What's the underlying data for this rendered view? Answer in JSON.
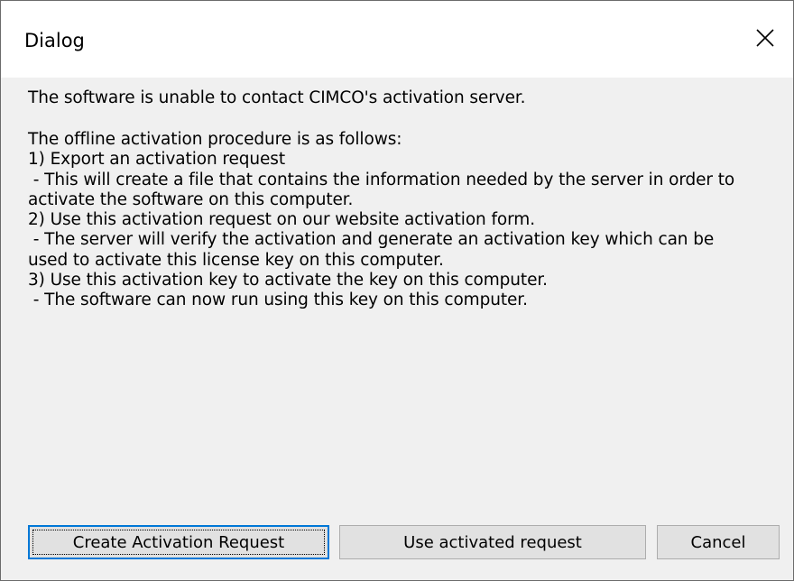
{
  "window": {
    "title": "Dialog"
  },
  "message": {
    "intro": "The software is unable to contact CIMCO's activation server.",
    "lines": [
      "The offline activation procedure is as follows:",
      "1) Export an activation request",
      " - This will create a file that contains the information needed by the server in order to",
      "activate the software on this computer.",
      "2) Use this activation request on our website activation form.",
      " - The server will verify the activation and generate an activation key which can be",
      "used to activate this license key on this computer.",
      "3) Use this activation key to activate the key on this computer.",
      " - The software can now run using this key on this computer."
    ]
  },
  "buttons": {
    "create_request": "Create Activation Request",
    "use_activated": "Use activated request",
    "cancel": "Cancel"
  },
  "icons": {
    "close": "close-icon"
  },
  "colors": {
    "titlebar": "#ffffff",
    "background": "#f0f0f0",
    "default_button_border": "#0078d7",
    "button_face": "#e1e1e1"
  }
}
